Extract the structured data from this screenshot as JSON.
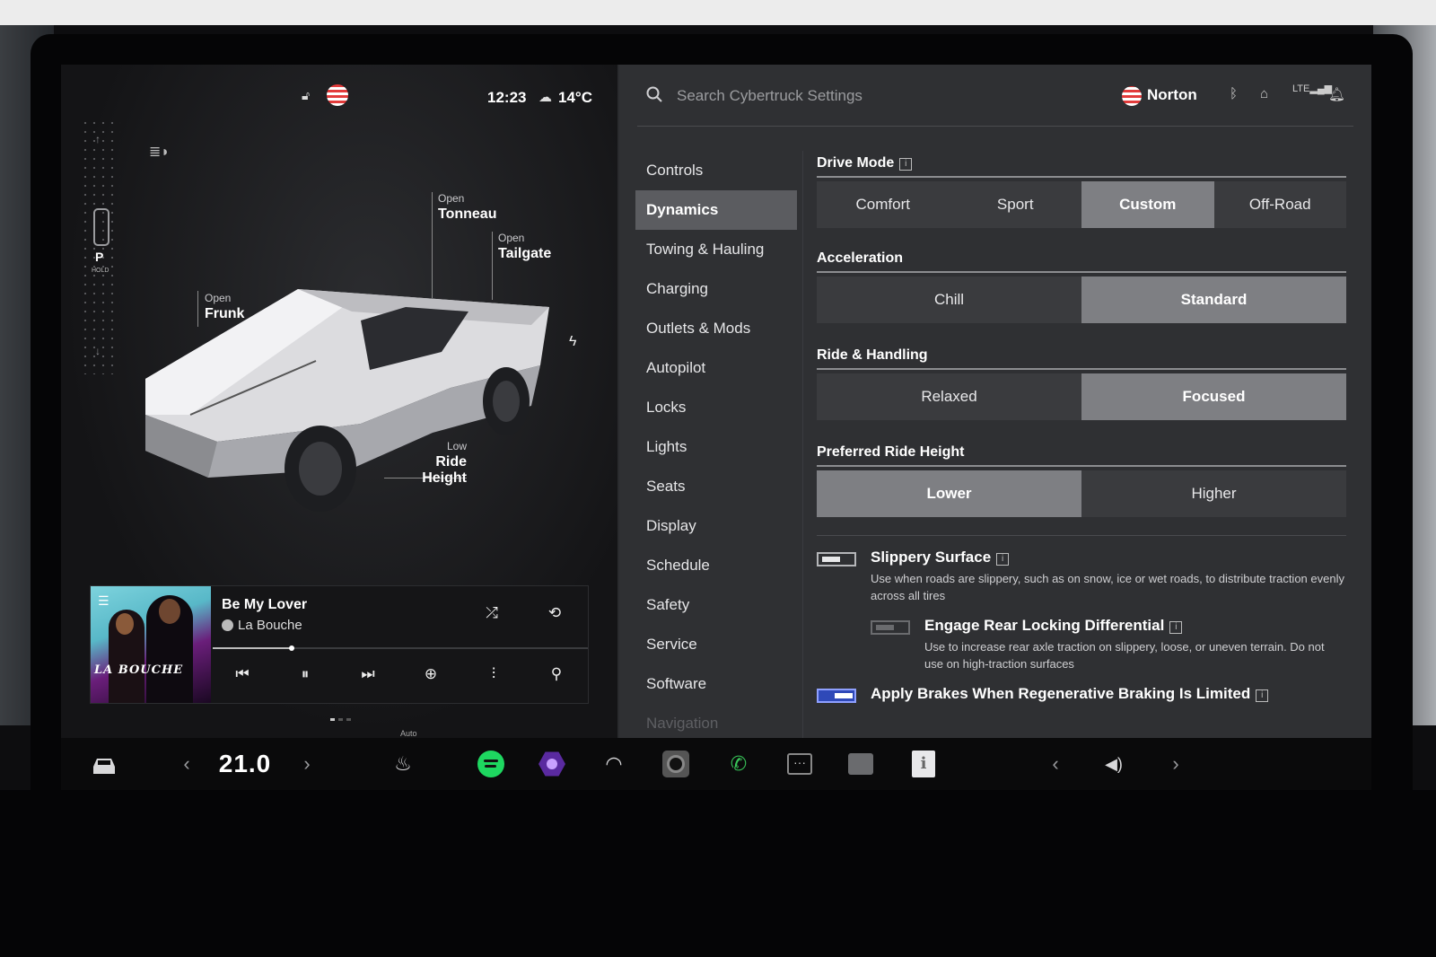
{
  "status": {
    "time": "12:23",
    "temperature": "14°C",
    "weather_icon": "cloud-icon",
    "lock_icon": "unlock-icon"
  },
  "vehicle": {
    "gear": "P",
    "gear_sub": "HOLD",
    "callouts": {
      "tonneau": {
        "state": "Open",
        "label": "Tonneau"
      },
      "tailgate": {
        "state": "Open",
        "label": "Tailgate"
      },
      "frunk": {
        "state": "Open",
        "label": "Frunk"
      },
      "ride_height": {
        "state": "Low",
        "label": "Ride Height"
      }
    }
  },
  "media": {
    "song": "Be My Lover",
    "artist": "La Bouche",
    "album_text": "LA BOUCHE",
    "progress": 0.21
  },
  "search": {
    "placeholder": "Search Cybertruck Settings"
  },
  "header": {
    "user": "Norton",
    "icons": [
      "bluetooth-icon",
      "home-icon",
      "lte-signal-icon",
      "bell-icon"
    ],
    "lte": "LTE"
  },
  "nav": {
    "items": [
      {
        "label": "Controls"
      },
      {
        "label": "Dynamics",
        "active": true
      },
      {
        "label": "Towing & Hauling"
      },
      {
        "label": "Charging"
      },
      {
        "label": "Outlets & Mods"
      },
      {
        "label": "Autopilot"
      },
      {
        "label": "Locks"
      },
      {
        "label": "Lights"
      },
      {
        "label": "Seats"
      },
      {
        "label": "Display"
      },
      {
        "label": "Schedule"
      },
      {
        "label": "Safety"
      },
      {
        "label": "Service"
      },
      {
        "label": "Software"
      },
      {
        "label": "Navigation"
      }
    ]
  },
  "dynamics": {
    "drive_mode": {
      "title": "Drive Mode",
      "options": [
        "Comfort",
        "Sport",
        "Custom",
        "Off-Road"
      ],
      "selected": "Custom"
    },
    "acceleration": {
      "title": "Acceleration",
      "options": [
        "Chill",
        "Standard"
      ],
      "selected": "Standard"
    },
    "ride_handling": {
      "title": "Ride & Handling",
      "options": [
        "Relaxed",
        "Focused"
      ],
      "selected": "Focused"
    },
    "ride_height": {
      "title": "Preferred Ride Height",
      "options": [
        "Lower",
        "Higher"
      ],
      "selected": "Lower"
    },
    "toggles": {
      "slippery": {
        "title": "Slippery Surface",
        "desc": "Use when roads are slippery, such as on snow, ice or wet roads, to distribute traction evenly across all tires",
        "on": false
      },
      "rear_diff": {
        "title": "Engage Rear Locking Differential",
        "desc": "Use to increase rear axle traction on slippery, loose, or uneven terrain. Do not use on high-traction surfaces",
        "on": false
      },
      "regen": {
        "title": "Apply Brakes When Regenerative Braking Is Limited",
        "on": true
      }
    }
  },
  "dock": {
    "cabin_temp": "21.0",
    "seat_heat_label": "Auto",
    "apps": [
      "car-icon",
      "seat-heat-icon",
      "spotify-icon",
      "hex-app-icon",
      "wiper-icon",
      "camera-icon",
      "phone-icon",
      "more-icon",
      "card-app-icon",
      "info-app-icon",
      "volume-icon"
    ]
  }
}
